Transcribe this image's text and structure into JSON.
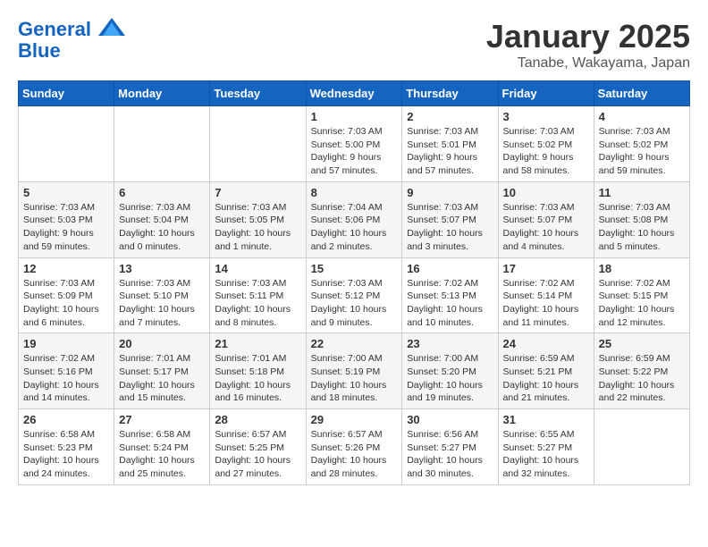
{
  "header": {
    "logo_line1": "General",
    "logo_line2": "Blue",
    "month": "January 2025",
    "location": "Tanabe, Wakayama, Japan"
  },
  "weekdays": [
    "Sunday",
    "Monday",
    "Tuesday",
    "Wednesday",
    "Thursday",
    "Friday",
    "Saturday"
  ],
  "weeks": [
    [
      {
        "day": "",
        "info": ""
      },
      {
        "day": "",
        "info": ""
      },
      {
        "day": "",
        "info": ""
      },
      {
        "day": "1",
        "info": "Sunrise: 7:03 AM\nSunset: 5:00 PM\nDaylight: 9 hours\nand 57 minutes."
      },
      {
        "day": "2",
        "info": "Sunrise: 7:03 AM\nSunset: 5:01 PM\nDaylight: 9 hours\nand 57 minutes."
      },
      {
        "day": "3",
        "info": "Sunrise: 7:03 AM\nSunset: 5:02 PM\nDaylight: 9 hours\nand 58 minutes."
      },
      {
        "day": "4",
        "info": "Sunrise: 7:03 AM\nSunset: 5:02 PM\nDaylight: 9 hours\nand 59 minutes."
      }
    ],
    [
      {
        "day": "5",
        "info": "Sunrise: 7:03 AM\nSunset: 5:03 PM\nDaylight: 9 hours\nand 59 minutes."
      },
      {
        "day": "6",
        "info": "Sunrise: 7:03 AM\nSunset: 5:04 PM\nDaylight: 10 hours\nand 0 minutes."
      },
      {
        "day": "7",
        "info": "Sunrise: 7:03 AM\nSunset: 5:05 PM\nDaylight: 10 hours\nand 1 minute."
      },
      {
        "day": "8",
        "info": "Sunrise: 7:04 AM\nSunset: 5:06 PM\nDaylight: 10 hours\nand 2 minutes."
      },
      {
        "day": "9",
        "info": "Sunrise: 7:03 AM\nSunset: 5:07 PM\nDaylight: 10 hours\nand 3 minutes."
      },
      {
        "day": "10",
        "info": "Sunrise: 7:03 AM\nSunset: 5:07 PM\nDaylight: 10 hours\nand 4 minutes."
      },
      {
        "day": "11",
        "info": "Sunrise: 7:03 AM\nSunset: 5:08 PM\nDaylight: 10 hours\nand 5 minutes."
      }
    ],
    [
      {
        "day": "12",
        "info": "Sunrise: 7:03 AM\nSunset: 5:09 PM\nDaylight: 10 hours\nand 6 minutes."
      },
      {
        "day": "13",
        "info": "Sunrise: 7:03 AM\nSunset: 5:10 PM\nDaylight: 10 hours\nand 7 minutes."
      },
      {
        "day": "14",
        "info": "Sunrise: 7:03 AM\nSunset: 5:11 PM\nDaylight: 10 hours\nand 8 minutes."
      },
      {
        "day": "15",
        "info": "Sunrise: 7:03 AM\nSunset: 5:12 PM\nDaylight: 10 hours\nand 9 minutes."
      },
      {
        "day": "16",
        "info": "Sunrise: 7:02 AM\nSunset: 5:13 PM\nDaylight: 10 hours\nand 10 minutes."
      },
      {
        "day": "17",
        "info": "Sunrise: 7:02 AM\nSunset: 5:14 PM\nDaylight: 10 hours\nand 11 minutes."
      },
      {
        "day": "18",
        "info": "Sunrise: 7:02 AM\nSunset: 5:15 PM\nDaylight: 10 hours\nand 12 minutes."
      }
    ],
    [
      {
        "day": "19",
        "info": "Sunrise: 7:02 AM\nSunset: 5:16 PM\nDaylight: 10 hours\nand 14 minutes."
      },
      {
        "day": "20",
        "info": "Sunrise: 7:01 AM\nSunset: 5:17 PM\nDaylight: 10 hours\nand 15 minutes."
      },
      {
        "day": "21",
        "info": "Sunrise: 7:01 AM\nSunset: 5:18 PM\nDaylight: 10 hours\nand 16 minutes."
      },
      {
        "day": "22",
        "info": "Sunrise: 7:00 AM\nSunset: 5:19 PM\nDaylight: 10 hours\nand 18 minutes."
      },
      {
        "day": "23",
        "info": "Sunrise: 7:00 AM\nSunset: 5:20 PM\nDaylight: 10 hours\nand 19 minutes."
      },
      {
        "day": "24",
        "info": "Sunrise: 6:59 AM\nSunset: 5:21 PM\nDaylight: 10 hours\nand 21 minutes."
      },
      {
        "day": "25",
        "info": "Sunrise: 6:59 AM\nSunset: 5:22 PM\nDaylight: 10 hours\nand 22 minutes."
      }
    ],
    [
      {
        "day": "26",
        "info": "Sunrise: 6:58 AM\nSunset: 5:23 PM\nDaylight: 10 hours\nand 24 minutes."
      },
      {
        "day": "27",
        "info": "Sunrise: 6:58 AM\nSunset: 5:24 PM\nDaylight: 10 hours\nand 25 minutes."
      },
      {
        "day": "28",
        "info": "Sunrise: 6:57 AM\nSunset: 5:25 PM\nDaylight: 10 hours\nand 27 minutes."
      },
      {
        "day": "29",
        "info": "Sunrise: 6:57 AM\nSunset: 5:26 PM\nDaylight: 10 hours\nand 28 minutes."
      },
      {
        "day": "30",
        "info": "Sunrise: 6:56 AM\nSunset: 5:27 PM\nDaylight: 10 hours\nand 30 minutes."
      },
      {
        "day": "31",
        "info": "Sunrise: 6:55 AM\nSunset: 5:27 PM\nDaylight: 10 hours\nand 32 minutes."
      },
      {
        "day": "",
        "info": ""
      }
    ]
  ]
}
